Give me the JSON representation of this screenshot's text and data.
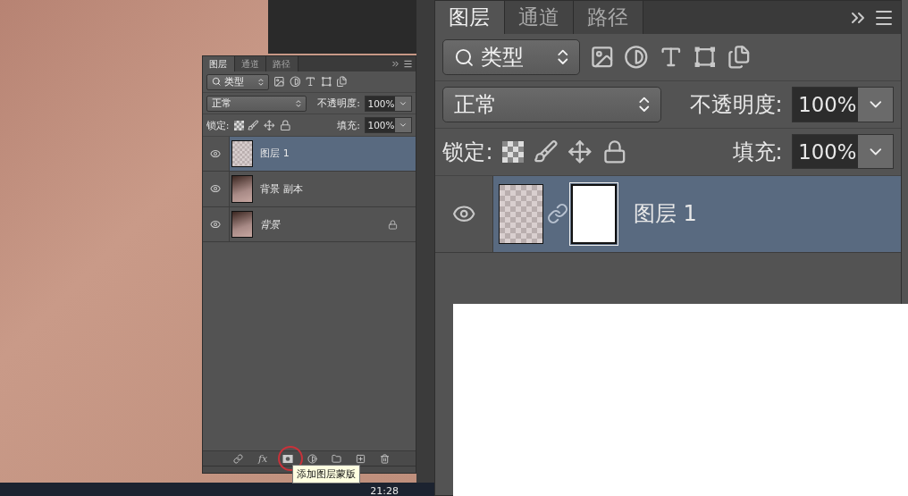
{
  "small_panel": {
    "tabs": [
      {
        "label": "图层",
        "selected": true
      },
      {
        "label": "通道",
        "selected": false
      },
      {
        "label": "路径",
        "selected": false
      }
    ],
    "filter": "类型",
    "blend_mode": "正常",
    "opacity_label": "不透明度:",
    "opacity": "100%",
    "lock_label": "锁定:",
    "fill_label": "填充:",
    "fill": "100%",
    "layers": [
      {
        "name": "图层 1",
        "kind": "transparent",
        "selected": true,
        "visible": true,
        "locked": false,
        "has_mask": false
      },
      {
        "name": "背景 副本",
        "kind": "photo",
        "selected": false,
        "visible": true,
        "locked": false,
        "has_mask": false
      },
      {
        "name": "背景",
        "kind": "background",
        "selected": false,
        "visible": true,
        "locked": true,
        "has_mask": false
      }
    ],
    "toolbar": {
      "effects_label": "fx"
    }
  },
  "tooltip": "添加图层蒙版",
  "zoomed_panel": {
    "tabs": [
      {
        "label": "图层",
        "selected": true
      },
      {
        "label": "通道",
        "selected": false
      },
      {
        "label": "路径",
        "selected": false
      }
    ],
    "filter": "类型",
    "blend_mode": "正常",
    "opacity_label": "不透明度:",
    "opacity": "100%",
    "lock_label": "锁定:",
    "fill_label": "填充:",
    "fill": "100%",
    "layers": [
      {
        "name": "图层 1",
        "kind": "transparent",
        "selected": true,
        "visible": true,
        "locked": false,
        "has_mask": true
      }
    ]
  },
  "taskbar": {
    "time": "21:28"
  }
}
